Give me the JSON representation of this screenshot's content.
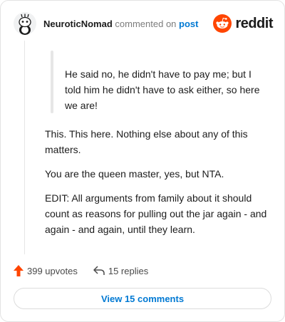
{
  "comment": {
    "author": "NeuroticNomad",
    "verb": "commented on",
    "post_link": "post",
    "brand": "reddit",
    "quote": "He said no, he didn't have to pay me; but I told him he didn't have to ask either, so here we are!",
    "paragraphs": [
      "This. This here. Nothing else about any of this matters.",
      "You are the queen master, yes, but NTA.",
      "EDIT: All arguments from family about it should count as reasons for pulling out the jar again - and again - and again, until they learn."
    ]
  },
  "actions": {
    "upvotes": "399 upvotes",
    "replies": "15 replies",
    "view_comments": "View 15 comments"
  },
  "colors": {
    "upvote": "#ff4500",
    "link": "#0079d3",
    "brand": "#ff4500"
  }
}
